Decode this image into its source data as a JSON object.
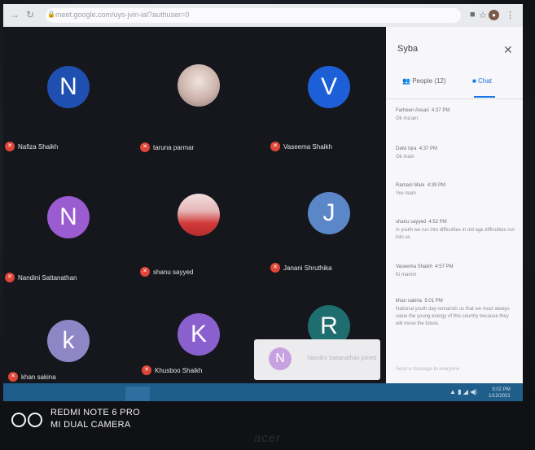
{
  "browser": {
    "url": "meet.google.com/uys-jvin-ial?authuser=0"
  },
  "meeting": {
    "participants": [
      {
        "name": "Nafiza Shaikh",
        "initial": "N",
        "color": "#1f4fb0",
        "photo": false
      },
      {
        "name": "taruna parmar",
        "initial": "",
        "color": "#d9c7c0",
        "photo": true
      },
      {
        "name": "Vaseema Shaikh",
        "initial": "V",
        "color": "#1c5fd6",
        "photo": false
      },
      {
        "name": "Nandini Sattanathan",
        "initial": "N",
        "color": "#9b5bd1",
        "photo": false
      },
      {
        "name": "shanu sayyed",
        "initial": "",
        "color": "#e2c4c4",
        "photo": true
      },
      {
        "name": "Janani Shruthika",
        "initial": "J",
        "color": "#5b87c9",
        "photo": false
      },
      {
        "name": "khan sakina",
        "initial": "k",
        "color": "#8f86c6",
        "photo": false
      },
      {
        "name": "Khusboo Shaikh",
        "initial": "K",
        "color": "#8a5fce",
        "photo": false
      },
      {
        "name": "",
        "initial": "R",
        "color": "#1f6e6f",
        "photo": false
      }
    ]
  },
  "panel": {
    "title": "Syba",
    "tabs": {
      "people": "People (12)",
      "chat": "Chat"
    },
    "messages": [
      {
        "sender": "Farheen Ansari",
        "time": "4:37 PM",
        "text": "Ok ma'am"
      },
      {
        "sender": "Dalvi Iqra",
        "time": "4:37 PM",
        "text": "Ok mam"
      },
      {
        "sender": "Ramani Mani",
        "time": "4:39 PM",
        "text": "Yes mam"
      },
      {
        "sender": "shanu sayyed",
        "time": "4:52 PM",
        "text": "in youth we run into difficulties in old age difficulties run into us"
      },
      {
        "sender": "Vaseema Shaikh",
        "time": "4:57 PM",
        "text": "Ki mamm"
      },
      {
        "sender": "khan sakina",
        "time": "5:01 PM",
        "text": "National youth day remainds us that we must always value the young energy of this country because they will move the future."
      }
    ],
    "send_placeholder": "Send a message to everyone"
  },
  "toast": {
    "initial": "N",
    "text": "Nandini Sattanathan joined"
  },
  "taskbar": {
    "time": "5:02 PM",
    "date": "1/12/2021"
  },
  "watermark": {
    "line1": "REDMI NOTE 6 PRO",
    "line2": "MI DUAL CAMERA"
  },
  "bezel_brand": "acer"
}
